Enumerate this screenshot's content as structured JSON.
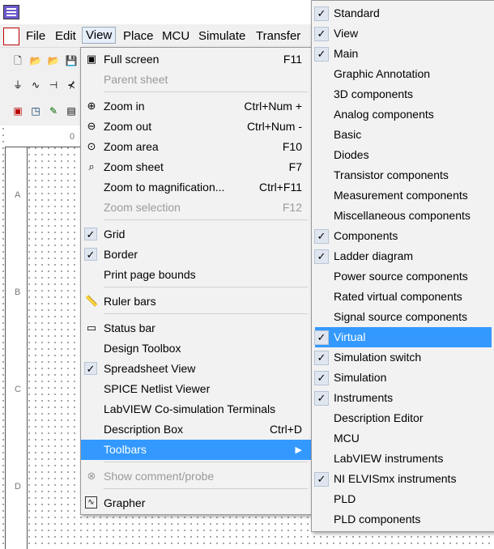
{
  "menubar": {
    "items": [
      "File",
      "Edit",
      "View",
      "Place",
      "MCU",
      "Simulate",
      "Transfer"
    ]
  },
  "schematic": {
    "ruler_top_label": "0",
    "row_labels": [
      "A",
      "B",
      "C",
      "D"
    ]
  },
  "view_menu": {
    "items": [
      {
        "label": "Full screen",
        "shortcut": "F11",
        "icon": "full-screen-icon",
        "enabled": true
      },
      {
        "label": "Parent sheet",
        "shortcut": "",
        "icon": "",
        "enabled": false
      },
      {
        "label": "Zoom in",
        "shortcut": "Ctrl+Num +",
        "icon": "zoom-in-icon",
        "enabled": true
      },
      {
        "label": "Zoom out",
        "shortcut": "Ctrl+Num -",
        "icon": "zoom-out-icon",
        "enabled": true
      },
      {
        "label": "Zoom area",
        "shortcut": "F10",
        "icon": "zoom-area-icon",
        "enabled": true
      },
      {
        "label": "Zoom sheet",
        "shortcut": "F7",
        "icon": "zoom-sheet-icon",
        "enabled": true
      },
      {
        "label": "Zoom to magnification...",
        "shortcut": "Ctrl+F11",
        "icon": "",
        "enabled": true
      },
      {
        "label": "Zoom selection",
        "shortcut": "F12",
        "icon": "",
        "enabled": false
      },
      {
        "label": "Grid",
        "shortcut": "",
        "icon": "check-icon",
        "enabled": true
      },
      {
        "label": "Border",
        "shortcut": "",
        "icon": "check-icon",
        "enabled": true
      },
      {
        "label": "Print page bounds",
        "shortcut": "",
        "icon": "",
        "enabled": true
      },
      {
        "label": "Ruler bars",
        "shortcut": "",
        "icon": "ruler-icon",
        "enabled": true
      },
      {
        "label": "Status bar",
        "shortcut": "",
        "icon": "status-bar-icon",
        "enabled": true
      },
      {
        "label": "Design Toolbox",
        "shortcut": "",
        "icon": "",
        "enabled": true
      },
      {
        "label": "Spreadsheet View",
        "shortcut": "",
        "icon": "check-icon",
        "enabled": true
      },
      {
        "label": "SPICE Netlist Viewer",
        "shortcut": "",
        "icon": "",
        "enabled": true
      },
      {
        "label": "LabVIEW Co-simulation Terminals",
        "shortcut": "",
        "icon": "",
        "enabled": true
      },
      {
        "label": "Description Box",
        "shortcut": "Ctrl+D",
        "icon": "",
        "enabled": true
      },
      {
        "label": "Toolbars",
        "shortcut": "",
        "icon": "",
        "enabled": true
      },
      {
        "label": "Show comment/probe",
        "shortcut": "",
        "icon": "comment-icon",
        "enabled": false
      },
      {
        "label": "Grapher",
        "shortcut": "",
        "icon": "grapher-icon",
        "enabled": true
      }
    ]
  },
  "toolbars_menu": {
    "items": [
      {
        "label": "Standard",
        "checked": true
      },
      {
        "label": "View",
        "checked": true
      },
      {
        "label": "Main",
        "checked": true
      },
      {
        "label": "Graphic Annotation",
        "checked": false
      },
      {
        "label": "3D components",
        "checked": false
      },
      {
        "label": "Analog components",
        "checked": false
      },
      {
        "label": "Basic",
        "checked": false
      },
      {
        "label": "Diodes",
        "checked": false
      },
      {
        "label": "Transistor components",
        "checked": false
      },
      {
        "label": "Measurement components",
        "checked": false
      },
      {
        "label": "Miscellaneous components",
        "checked": false
      },
      {
        "label": "Components",
        "checked": true
      },
      {
        "label": "Ladder diagram",
        "checked": true
      },
      {
        "label": "Power source components",
        "checked": false
      },
      {
        "label": "Rated virtual components",
        "checked": false
      },
      {
        "label": "Signal source components",
        "checked": false
      },
      {
        "label": "Virtual",
        "checked": true
      },
      {
        "label": "Simulation switch",
        "checked": true
      },
      {
        "label": "Simulation",
        "checked": true
      },
      {
        "label": "Instruments",
        "checked": true
      },
      {
        "label": "Description Editor",
        "checked": false
      },
      {
        "label": "MCU",
        "checked": false
      },
      {
        "label": "LabVIEW instruments",
        "checked": false
      },
      {
        "label": "NI ELVISmx instruments",
        "checked": true
      },
      {
        "label": "PLD",
        "checked": false
      },
      {
        "label": "PLD components",
        "checked": false
      }
    ],
    "highlighted": "Virtual"
  },
  "colors": {
    "highlight": "#3399ff",
    "menu_bg": "#f2f2f2",
    "disabled_text": "#9a9a9a"
  }
}
